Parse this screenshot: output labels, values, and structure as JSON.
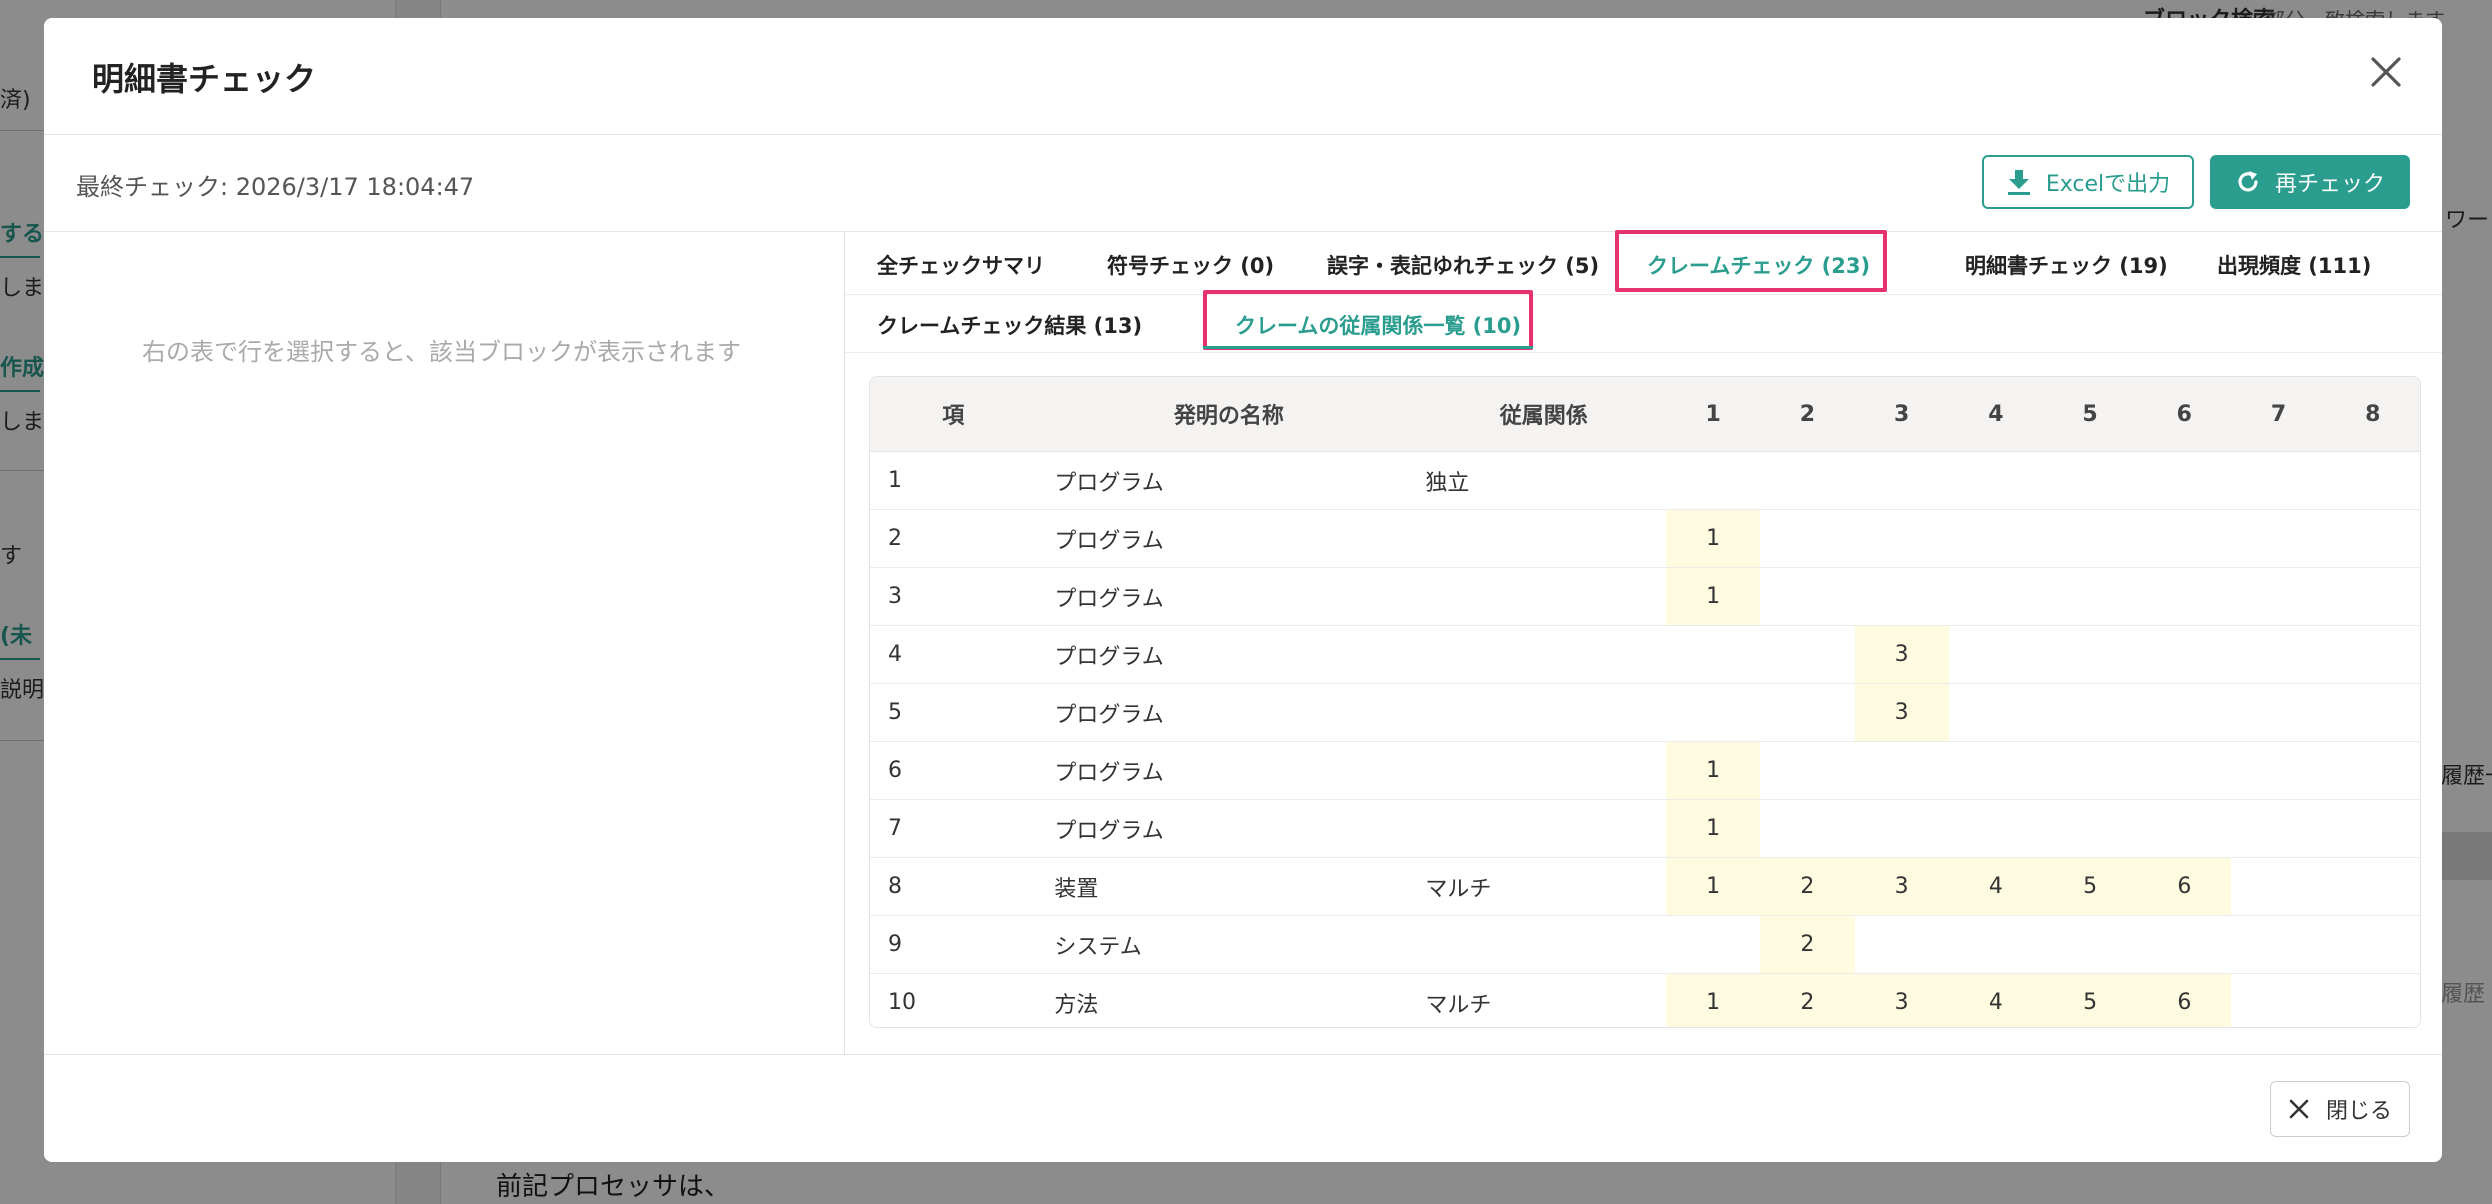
{
  "background": {
    "left_fragments": [
      "済)",
      "する",
      "しま",
      "作成",
      "します",
      "す",
      "(未",
      "説明"
    ],
    "right_fragments": [
      "ブロック検索",
      "部分一致検索します",
      "ワー",
      "履歴一",
      "履歴"
    ],
    "center_text": "前記プロセッサは、"
  },
  "modal": {
    "title": "明細書チェック",
    "last_check": "最終チェック: 2026/3/17 18:04:47",
    "excel_button": "Excelで出力",
    "recheck_button": "再チェック",
    "left_hint": "右の表で行を選択すると、該当ブロックが表示されます",
    "close_button": "閉じる"
  },
  "tabs_row1": [
    {
      "label": "全チェックサマリ",
      "active": false
    },
    {
      "label": "符号チェック (0)",
      "active": false
    },
    {
      "label": "誤字・表記ゆれチェック (5)",
      "active": false
    },
    {
      "label": "クレームチェック (23)",
      "active": true
    },
    {
      "label": "明細書チェック (19)",
      "active": false
    },
    {
      "label": "出現頻度 (111)",
      "active": false
    }
  ],
  "tabs_row2": [
    {
      "label": "クレームチェック結果 (13)",
      "active": false
    },
    {
      "label": "クレームの従属関係一覧 (10)",
      "active": true
    }
  ],
  "table": {
    "headers": [
      "項",
      "発明の名称",
      "従属関係",
      "1",
      "2",
      "3",
      "4",
      "5",
      "6",
      "7",
      "8"
    ],
    "rows": [
      {
        "no": "1",
        "name": "プログラム",
        "dep": "独立",
        "cols": [
          "",
          "",
          "",
          "",
          "",
          "",
          "",
          ""
        ]
      },
      {
        "no": "2",
        "name": "プログラム",
        "dep": "",
        "cols": [
          "1",
          "",
          "",
          "",
          "",
          "",
          "",
          ""
        ]
      },
      {
        "no": "3",
        "name": "プログラム",
        "dep": "",
        "cols": [
          "1",
          "",
          "",
          "",
          "",
          "",
          "",
          ""
        ]
      },
      {
        "no": "4",
        "name": "プログラム",
        "dep": "",
        "cols": [
          "",
          "",
          "3",
          "",
          "",
          "",
          "",
          ""
        ]
      },
      {
        "no": "5",
        "name": "プログラム",
        "dep": "",
        "cols": [
          "",
          "",
          "3",
          "",
          "",
          "",
          "",
          ""
        ]
      },
      {
        "no": "6",
        "name": "プログラム",
        "dep": "",
        "cols": [
          "1",
          "",
          "",
          "",
          "",
          "",
          "",
          ""
        ]
      },
      {
        "no": "7",
        "name": "プログラム",
        "dep": "",
        "cols": [
          "1",
          "",
          "",
          "",
          "",
          "",
          "",
          ""
        ]
      },
      {
        "no": "8",
        "name": "装置",
        "dep": "マルチ",
        "cols": [
          "1",
          "2",
          "3",
          "4",
          "5",
          "6",
          "",
          ""
        ]
      },
      {
        "no": "9",
        "name": "システム",
        "dep": "",
        "cols": [
          "",
          "2",
          "",
          "",
          "",
          "",
          "",
          ""
        ]
      },
      {
        "no": "10",
        "name": "方法",
        "dep": "マルチ",
        "cols": [
          "1",
          "2",
          "3",
          "4",
          "5",
          "6",
          "",
          ""
        ]
      }
    ]
  },
  "colors": {
    "accent": "#2a9d8f",
    "highlight_box": "#e6336e",
    "cell_highlight": "#fefbe0"
  }
}
